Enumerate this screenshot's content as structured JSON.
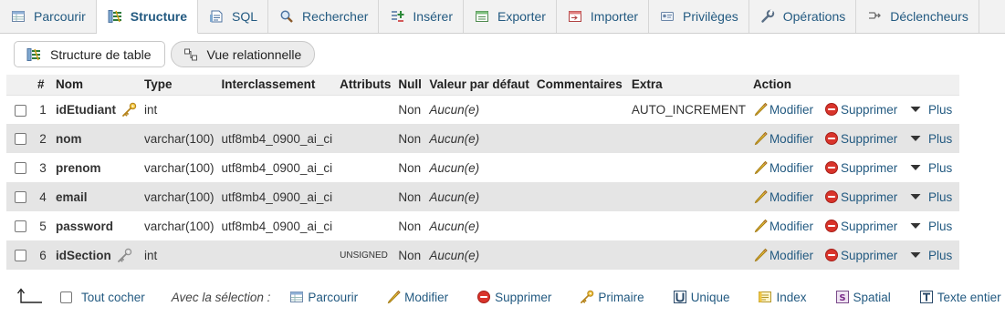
{
  "tabs": [
    {
      "id": "browse",
      "label": "Parcourir",
      "icon": "table-browse-icon",
      "active": false
    },
    {
      "id": "structure",
      "label": "Structure",
      "icon": "structure-icon",
      "active": true
    },
    {
      "id": "sql",
      "label": "SQL",
      "icon": "sql-icon",
      "active": false
    },
    {
      "id": "search",
      "label": "Rechercher",
      "icon": "search-icon",
      "active": false
    },
    {
      "id": "insert",
      "label": "Insérer",
      "icon": "insert-icon",
      "active": false
    },
    {
      "id": "export",
      "label": "Exporter",
      "icon": "export-icon",
      "active": false
    },
    {
      "id": "import",
      "label": "Importer",
      "icon": "import-icon",
      "active": false
    },
    {
      "id": "privileges",
      "label": "Privilèges",
      "icon": "privileges-icon",
      "active": false
    },
    {
      "id": "operations",
      "label": "Opérations",
      "icon": "wrench-icon",
      "active": false
    },
    {
      "id": "triggers",
      "label": "Déclencheurs",
      "icon": "triggers-icon",
      "active": false
    }
  ],
  "subtabs": {
    "table_structure": "Structure de table",
    "relation_view": "Vue relationnelle"
  },
  "table": {
    "headers": {
      "num": "#",
      "name": "Nom",
      "type": "Type",
      "collation": "Interclassement",
      "attributes": "Attributs",
      "null": "Null",
      "default": "Valeur par défaut",
      "comments": "Commentaires",
      "extra": "Extra",
      "action": "Action"
    },
    "rows": [
      {
        "num": "1",
        "name": "idEtudiant",
        "key": "primary",
        "type": "int",
        "collation": "",
        "attributes": "",
        "null": "Non",
        "default": "Aucun(e)",
        "comments": "",
        "extra": "AUTO_INCREMENT"
      },
      {
        "num": "2",
        "name": "nom",
        "key": "",
        "type": "varchar(100)",
        "collation": "utf8mb4_0900_ai_ci",
        "attributes": "",
        "null": "Non",
        "default": "Aucun(e)",
        "comments": "",
        "extra": ""
      },
      {
        "num": "3",
        "name": "prenom",
        "key": "",
        "type": "varchar(100)",
        "collation": "utf8mb4_0900_ai_ci",
        "attributes": "",
        "null": "Non",
        "default": "Aucun(e)",
        "comments": "",
        "extra": ""
      },
      {
        "num": "4",
        "name": "email",
        "key": "",
        "type": "varchar(100)",
        "collation": "utf8mb4_0900_ai_ci",
        "attributes": "",
        "null": "Non",
        "default": "Aucun(e)",
        "comments": "",
        "extra": ""
      },
      {
        "num": "5",
        "name": "password",
        "key": "",
        "type": "varchar(100)",
        "collation": "utf8mb4_0900_ai_ci",
        "attributes": "",
        "null": "Non",
        "default": "Aucun(e)",
        "comments": "",
        "extra": ""
      },
      {
        "num": "6",
        "name": "idSection",
        "key": "foreign",
        "type": "int",
        "collation": "",
        "attributes": "UNSIGNED",
        "null": "Non",
        "default": "Aucun(e)",
        "comments": "",
        "extra": ""
      }
    ],
    "actions": {
      "modify": "Modifier",
      "delete": "Supprimer",
      "more": "Plus"
    }
  },
  "bottom": {
    "check_all": "Tout cocher",
    "with_selection": "Avec la sélection :",
    "actions": [
      {
        "id": "browse",
        "label": "Parcourir",
        "icon": "table-browse-icon"
      },
      {
        "id": "modify",
        "label": "Modifier",
        "icon": "pencil-icon"
      },
      {
        "id": "delete",
        "label": "Supprimer",
        "icon": "delete-icon"
      },
      {
        "id": "primary",
        "label": "Primaire",
        "icon": "primary-key-icon"
      },
      {
        "id": "unique",
        "label": "Unique",
        "icon": "unique-icon"
      },
      {
        "id": "index",
        "label": "Index",
        "icon": "index-icon"
      },
      {
        "id": "spatial",
        "label": "Spatial",
        "icon": "spatial-icon"
      },
      {
        "id": "fulltext",
        "label": "Texte entier",
        "icon": "fulltext-icon"
      }
    ]
  },
  "colors": {
    "link": "#235a81",
    "row_alt": "#e5e5e5",
    "header_bg": "#f0f0f0",
    "delete_red": "#d9342b",
    "key_gold": "#d9a21b"
  }
}
